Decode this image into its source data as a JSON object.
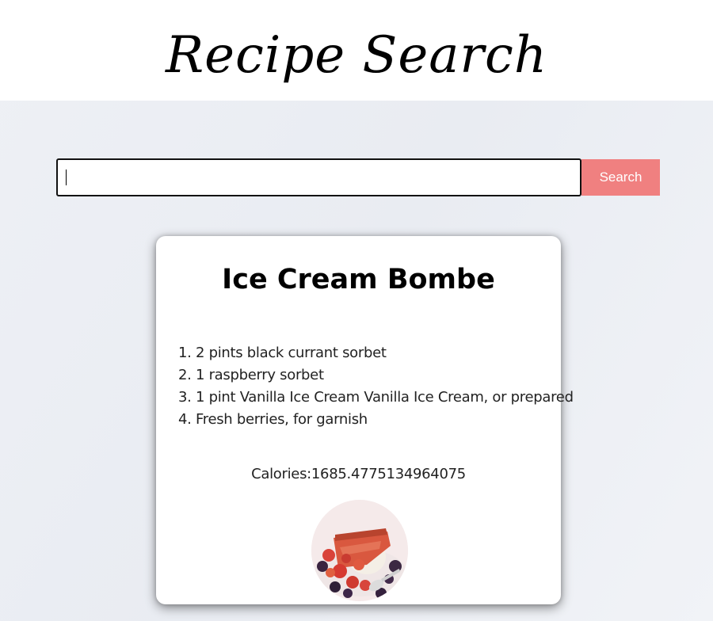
{
  "header": {
    "title": "Recipe Search"
  },
  "search": {
    "value": "",
    "button_label": "Search"
  },
  "recipe": {
    "title": "Ice Cream Bombe",
    "ingredients": [
      "2 pints black currant sorbet",
      "1 raspberry sorbet",
      "1 pint Vanilla Ice Cream Vanilla Ice Cream, or prepared",
      "Fresh berries, for garnish"
    ],
    "calories_text": "Calories:1685.4775134964075",
    "image_icon": "dessert-photo"
  },
  "colors": {
    "accent": "#f08080",
    "background": "#eceef3",
    "card": "#ffffff"
  }
}
